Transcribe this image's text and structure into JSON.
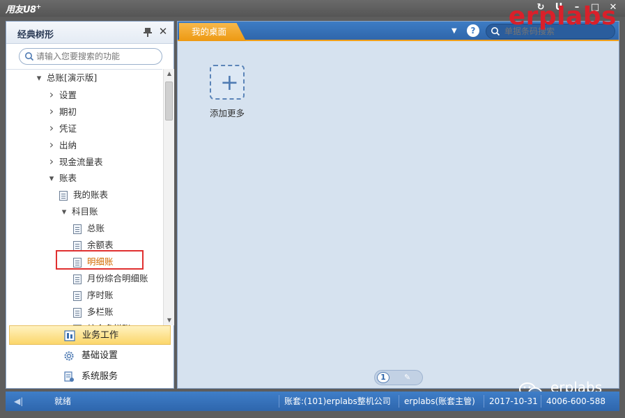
{
  "title_bar": {
    "app_logo": "用友U8",
    "app_logo_sup": "+",
    "icons": [
      "refresh-icon",
      "user-icon",
      "minimize-icon",
      "restore-icon",
      "close-icon"
    ]
  },
  "watermark": "erplabs",
  "left_panel": {
    "title": "经典树形",
    "search_placeholder": "请输入您要搜索的功能",
    "tree": [
      {
        "label": "总账[演示版]",
        "indent": 0,
        "arrow": "▼"
      },
      {
        "label": "设置",
        "indent": 1,
        "arrow": "▶"
      },
      {
        "label": "期初",
        "indent": 1,
        "arrow": "▶"
      },
      {
        "label": "凭证",
        "indent": 1,
        "arrow": "▶"
      },
      {
        "label": "出纳",
        "indent": 1,
        "arrow": "▶"
      },
      {
        "label": "现金流量表",
        "indent": 1,
        "arrow": "▶"
      },
      {
        "label": "账表",
        "indent": 1,
        "arrow": "▼"
      },
      {
        "label": "我的账表",
        "indent": 2,
        "arrow": "doc"
      },
      {
        "label": "科目账",
        "indent": 2,
        "arrow": "▼"
      },
      {
        "label": "总账",
        "indent": 3,
        "arrow": "doc"
      },
      {
        "label": "余额表",
        "indent": 3,
        "arrow": "doc"
      },
      {
        "label": "明细账",
        "indent": 3,
        "arrow": "doc"
      },
      {
        "label": "月份综合明细账",
        "indent": 3,
        "arrow": "doc"
      },
      {
        "label": "序时账",
        "indent": 3,
        "arrow": "doc"
      },
      {
        "label": "多栏账",
        "indent": 3,
        "arrow": "doc"
      },
      {
        "label": "综合多栏账",
        "indent": 3,
        "arrow": "doc"
      }
    ],
    "nav_buttons": [
      {
        "label": "业务工作",
        "active": true
      },
      {
        "label": "基础设置",
        "active": false
      },
      {
        "label": "系统服务",
        "active": false
      }
    ]
  },
  "main": {
    "tab_label": "我的桌面",
    "search_placeholder": "单据条码搜索",
    "add_more_label": "添加更多",
    "page_number": "1"
  },
  "wechat_label": "erplabs",
  "status_bar": {
    "ready": "就绪",
    "account": "账套:(101)erplabs整机公司",
    "user": "erplabs(账套主管)",
    "date": "2017-10-31",
    "phone": "4006-600-588"
  },
  "colors": {
    "accent_blue": "#2f66ab",
    "tab_orange": "#ed9912",
    "highlight_red": "#e03030",
    "watermark_red": "#d9202a"
  }
}
